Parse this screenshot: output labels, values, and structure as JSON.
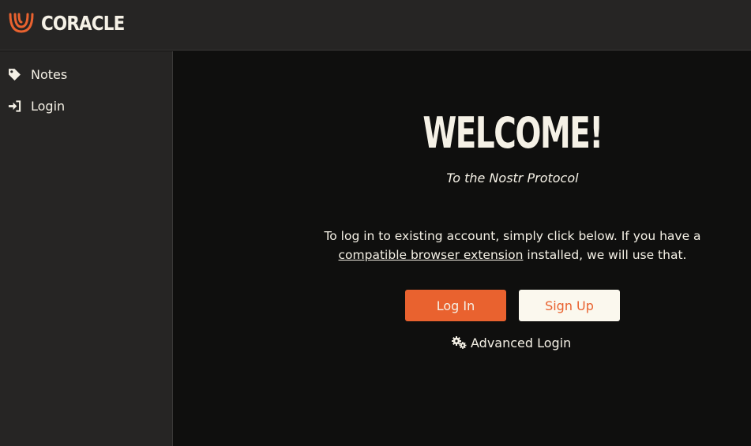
{
  "app": {
    "name": "CORACLE",
    "brand_color": "#e9622f"
  },
  "sidebar": {
    "items": [
      {
        "label": "Notes",
        "icon": "tag-icon"
      },
      {
        "label": "Login",
        "icon": "sign-in-icon"
      }
    ]
  },
  "main": {
    "heading": "WELCOME!",
    "subtitle": "To the Nostr Protocol",
    "intro_before": "To log in to existing account, simply click below. If you have a ",
    "intro_link": "compatible browser extension",
    "intro_after": " installed, we will use that.",
    "login_button": "Log In",
    "signup_button": "Sign Up",
    "advanced_login": "Advanced Login"
  }
}
